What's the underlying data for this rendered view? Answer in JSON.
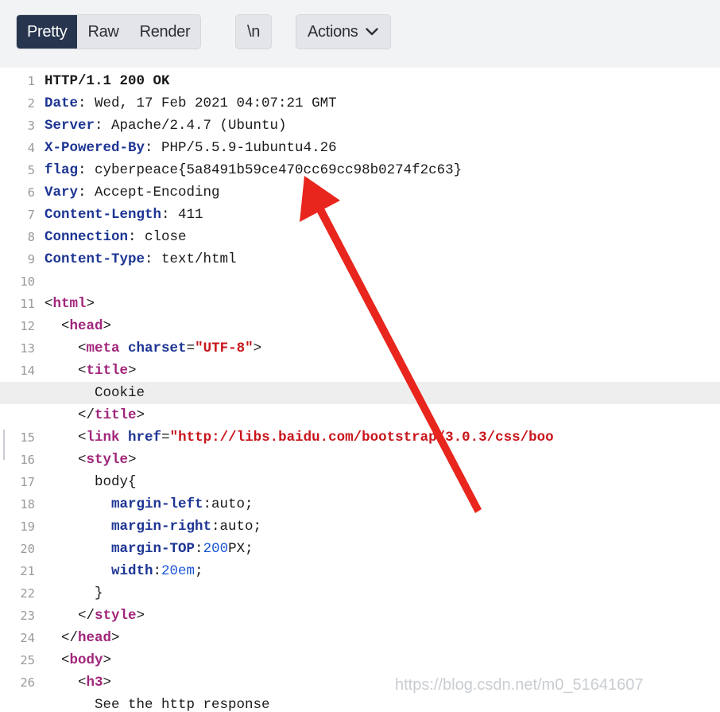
{
  "toolbar": {
    "tabs": [
      {
        "label": "Pretty",
        "active": true
      },
      {
        "label": "Raw",
        "active": false
      },
      {
        "label": "Render",
        "active": false
      }
    ],
    "newline_label": "\\n",
    "actions_label": "Actions",
    "actions_icon": "chevron-down-icon"
  },
  "editor": {
    "lines": [
      {
        "num": "1",
        "segs": [
          [
            "b",
            "HTTP/1.1 200 OK"
          ]
        ]
      },
      {
        "num": "2",
        "segs": [
          [
            "k",
            "Date"
          ],
          [
            "v",
            ": Wed, 17 Feb 2021 04:07:21 GMT"
          ]
        ]
      },
      {
        "num": "3",
        "segs": [
          [
            "k",
            "Server"
          ],
          [
            "v",
            ": Apache/2.4.7 (Ubuntu)"
          ]
        ]
      },
      {
        "num": "4",
        "segs": [
          [
            "k",
            "X-Powered-By"
          ],
          [
            "v",
            ": PHP/5.5.9-1ubuntu4.26"
          ]
        ]
      },
      {
        "num": "5",
        "segs": [
          [
            "k",
            "flag"
          ],
          [
            "v",
            ": cyberpeace{5a8491b59ce470cc69cc98b0274f2c63}"
          ]
        ]
      },
      {
        "num": "6",
        "segs": [
          [
            "k",
            "Vary"
          ],
          [
            "v",
            ": Accept-Encoding"
          ]
        ]
      },
      {
        "num": "7",
        "segs": [
          [
            "k",
            "Content-Length"
          ],
          [
            "v",
            ": 411"
          ]
        ]
      },
      {
        "num": "8",
        "segs": [
          [
            "k",
            "Connection"
          ],
          [
            "v",
            ": close"
          ]
        ]
      },
      {
        "num": "9",
        "segs": [
          [
            "k",
            "Content-Type"
          ],
          [
            "v",
            ": text/html"
          ]
        ]
      },
      {
        "num": "10",
        "segs": []
      },
      {
        "num": "11",
        "segs": [
          [
            "v",
            "<"
          ],
          [
            "t",
            "html"
          ],
          [
            "v",
            ">"
          ]
        ]
      },
      {
        "num": "12",
        "segs": [
          [
            "v",
            "  <"
          ],
          [
            "t",
            "head"
          ],
          [
            "v",
            ">"
          ]
        ]
      },
      {
        "num": "13",
        "segs": [
          [
            "v",
            "    <"
          ],
          [
            "t",
            "meta"
          ],
          [
            "v",
            " "
          ],
          [
            "a",
            "charset"
          ],
          [
            "v",
            "="
          ],
          [
            "s",
            "\"UTF-8\""
          ],
          [
            "v",
            ">"
          ]
        ]
      },
      {
        "num": "14",
        "segs": [
          [
            "v",
            "    <"
          ],
          [
            "t",
            "title"
          ],
          [
            "v",
            ">"
          ]
        ]
      },
      {
        "num": "",
        "segs": [
          [
            "v",
            "      Cookie"
          ]
        ],
        "highlight": true
      },
      {
        "num": "",
        "segs": [
          [
            "v",
            "    </"
          ],
          [
            "t",
            "title"
          ],
          [
            "v",
            ">"
          ]
        ]
      },
      {
        "num": "15",
        "segs": [
          [
            "v",
            "    <"
          ],
          [
            "t",
            "link"
          ],
          [
            "v",
            " "
          ],
          [
            "a",
            "href"
          ],
          [
            "v",
            "="
          ],
          [
            "s",
            "\"http://libs.baidu.com/bootstrap/3.0.3/css/boo"
          ]
        ]
      },
      {
        "num": "16",
        "segs": [
          [
            "v",
            "    <"
          ],
          [
            "t",
            "style"
          ],
          [
            "v",
            ">"
          ]
        ]
      },
      {
        "num": "17",
        "segs": [
          [
            "v",
            "      body{"
          ]
        ]
      },
      {
        "num": "18",
        "segs": [
          [
            "v",
            "        "
          ],
          [
            "a",
            "margin-left"
          ],
          [
            "v",
            ":auto;"
          ]
        ]
      },
      {
        "num": "19",
        "segs": [
          [
            "v",
            "        "
          ],
          [
            "a",
            "margin-right"
          ],
          [
            "v",
            ":auto;"
          ]
        ]
      },
      {
        "num": "20",
        "segs": [
          [
            "v",
            "        "
          ],
          [
            "a",
            "margin-TOP"
          ],
          [
            "v",
            ":"
          ],
          [
            "n",
            "200"
          ],
          [
            "v",
            "PX;"
          ]
        ]
      },
      {
        "num": "21",
        "segs": [
          [
            "v",
            "        "
          ],
          [
            "a",
            "width"
          ],
          [
            "v",
            ":"
          ],
          [
            "n",
            "20em"
          ],
          [
            "v",
            ";"
          ]
        ]
      },
      {
        "num": "22",
        "segs": [
          [
            "v",
            "      }"
          ]
        ]
      },
      {
        "num": "23",
        "segs": [
          [
            "v",
            "    </"
          ],
          [
            "t",
            "style"
          ],
          [
            "v",
            ">"
          ]
        ]
      },
      {
        "num": "24",
        "segs": [
          [
            "v",
            "  </"
          ],
          [
            "t",
            "head"
          ],
          [
            "v",
            ">"
          ]
        ]
      },
      {
        "num": "25",
        "segs": [
          [
            "v",
            "  <"
          ],
          [
            "t",
            "body"
          ],
          [
            "v",
            ">"
          ]
        ]
      },
      {
        "num": "26",
        "segs": [
          [
            "v",
            "    <"
          ],
          [
            "t",
            "h3"
          ],
          [
            "v",
            ">"
          ]
        ]
      },
      {
        "num": "",
        "segs": [
          [
            "v",
            "      See the http response"
          ]
        ]
      }
    ]
  },
  "watermark": "https://blog.csdn.net/m0_51641607",
  "colors": {
    "active_tab": "#27354e",
    "header_key": "#1d3593",
    "tag": "#a1267b",
    "string": "#c8151b",
    "number": "#1a55d6",
    "arrow": "#e8261e"
  }
}
